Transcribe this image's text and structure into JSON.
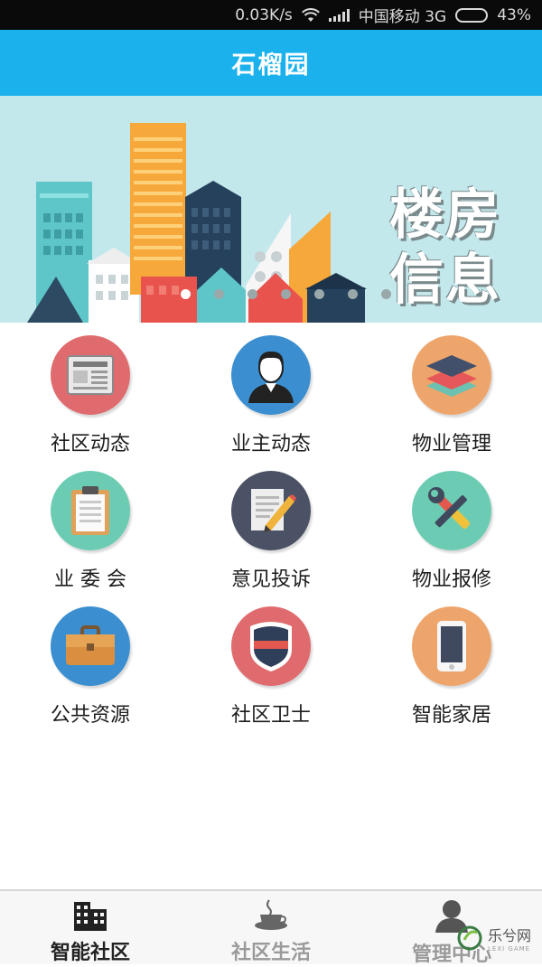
{
  "status_bar": {
    "speed": "0.03K/s",
    "carrier": "中国移动 3G",
    "battery": "43%",
    "battery_level": 0.43
  },
  "header": {
    "title": "石榴园"
  },
  "banner": {
    "text_line1": "楼房",
    "text_line2": "信息",
    "slides": 7,
    "active_slide": 0
  },
  "grid": [
    {
      "label": "社区动态",
      "icon": "newspaper-icon",
      "color": "#e06b6e"
    },
    {
      "label": "业主动态",
      "icon": "person-icon",
      "color": "#3b8fd0"
    },
    {
      "label": "物业管理",
      "icon": "layers-icon",
      "color": "#eea56c"
    },
    {
      "label": "业 委 会",
      "icon": "clipboard-icon",
      "color": "#6cccb3"
    },
    {
      "label": "意见投诉",
      "icon": "pencil-note-icon",
      "color": "#4b5266"
    },
    {
      "label": "物业报修",
      "icon": "tools-icon",
      "color": "#6cccb3"
    },
    {
      "label": "公共资源",
      "icon": "briefcase-icon",
      "color": "#3b8fd0"
    },
    {
      "label": "社区卫士",
      "icon": "shield-icon",
      "color": "#e06b6e"
    },
    {
      "label": "智能家居",
      "icon": "smartphone-icon",
      "color": "#eea56c"
    }
  ],
  "bottom_nav": [
    {
      "label": "智能社区",
      "icon": "buildings-icon",
      "active": true
    },
    {
      "label": "社区生活",
      "icon": "coffee-cup-icon",
      "active": false
    },
    {
      "label": "管理中心",
      "icon": "user-icon",
      "active": false
    }
  ],
  "watermark": {
    "text": "乐兮网",
    "sub": "LEXI GAME"
  }
}
